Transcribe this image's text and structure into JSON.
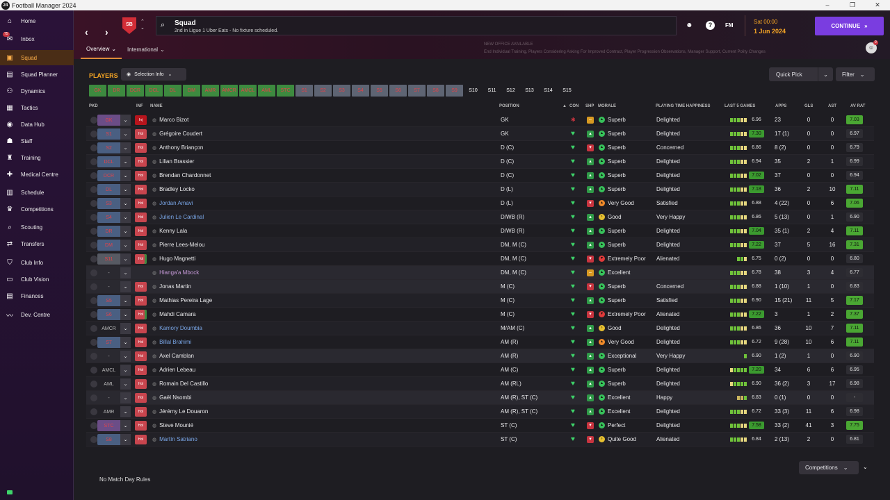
{
  "window": {
    "title": "Football Manager 2024",
    "app_icon": "24",
    "buttons": [
      "–",
      "❐",
      "✕"
    ]
  },
  "sidebar": {
    "items": [
      {
        "label": "Home",
        "icon": "home-icon",
        "glyph": "⌂"
      },
      {
        "label": "Inbox",
        "icon": "inbox-icon",
        "glyph": "✉",
        "badge": "75"
      },
      {
        "label": "Squad",
        "icon": "shirt-icon",
        "glyph": "▣",
        "active": true
      },
      {
        "label": "Squad Planner",
        "icon": "planner-icon",
        "glyph": "▤"
      },
      {
        "label": "Dynamics",
        "icon": "dynamics-icon",
        "glyph": "⚇"
      },
      {
        "label": "Tactics",
        "icon": "tactics-icon",
        "glyph": "▦"
      },
      {
        "label": "Data Hub",
        "icon": "data-hub-icon",
        "glyph": "◉"
      },
      {
        "label": "Staff",
        "icon": "staff-icon",
        "glyph": "☗"
      },
      {
        "label": "Training",
        "icon": "training-icon",
        "glyph": "♜"
      },
      {
        "label": "Medical Centre",
        "icon": "medical-icon",
        "glyph": "✚"
      },
      {
        "label": "Schedule",
        "icon": "schedule-icon",
        "glyph": "▥"
      },
      {
        "label": "Competitions",
        "icon": "trophy-icon",
        "glyph": "♛"
      },
      {
        "label": "Scouting",
        "icon": "scouting-icon",
        "glyph": "⌕"
      },
      {
        "label": "Transfers",
        "icon": "transfers-icon",
        "glyph": "⇄"
      },
      {
        "label": "Club Info",
        "icon": "club-info-icon",
        "glyph": "⛉"
      },
      {
        "label": "Club Vision",
        "icon": "club-vision-icon",
        "glyph": "▭"
      },
      {
        "label": "Finances",
        "icon": "finances-icon",
        "glyph": "▤"
      },
      {
        "label": "Dev. Centre",
        "icon": "dev-centre-icon",
        "glyph": "〰"
      }
    ]
  },
  "header": {
    "club_crest": "SB",
    "title": "Squad",
    "subtitle": "2nd in Ligue 1 Uber Eats - No fixture scheduled.",
    "fm_label": "FM",
    "date_line1": "Sat 00:00",
    "date_line2": "1 Jun 2024",
    "continue_label": "CONTINUE",
    "tabs": [
      "Overview",
      "International"
    ],
    "news_title": "NEW OFFICE AVAILABLE",
    "news_text": "End Individual Training, Players Considering Asking For Improved Contract, Player Progression Observations, Manager Support, Current Polity Changes",
    "avatar_badge": "9"
  },
  "toolbar": {
    "players_label": "PLAYERS",
    "selection_info_label": "Selection Info",
    "quick_pick_label": "Quick Pick",
    "filter_label": "Filter"
  },
  "positions": [
    {
      "label": "GK",
      "style": "green"
    },
    {
      "label": "DR",
      "style": "green"
    },
    {
      "label": "DCR",
      "style": "green"
    },
    {
      "label": "DCL",
      "style": "green"
    },
    {
      "label": "DL",
      "style": "green"
    },
    {
      "label": "DM",
      "style": "green"
    },
    {
      "label": "AMR",
      "style": "green"
    },
    {
      "label": "AMCR",
      "style": "green"
    },
    {
      "label": "AMCL",
      "style": "green"
    },
    {
      "label": "AML",
      "style": "green"
    },
    {
      "label": "STC",
      "style": "green"
    },
    {
      "label": "S1",
      "style": "gray"
    },
    {
      "label": "S2",
      "style": "gray"
    },
    {
      "label": "S3",
      "style": "gray"
    },
    {
      "label": "S4",
      "style": "gray"
    },
    {
      "label": "S5",
      "style": "gray"
    },
    {
      "label": "S6",
      "style": "gray"
    },
    {
      "label": "S7",
      "style": "gray"
    },
    {
      "label": "S8",
      "style": "gray"
    },
    {
      "label": "S9",
      "style": "gray"
    },
    {
      "label": "S10",
      "style": "plain"
    },
    {
      "label": "S11",
      "style": "plain"
    },
    {
      "label": "S12",
      "style": "plain"
    },
    {
      "label": "S13",
      "style": "plain"
    },
    {
      "label": "S14",
      "style": "plain"
    },
    {
      "label": "S15",
      "style": "plain"
    }
  ],
  "columns": {
    "pkd": "PKD",
    "inf": "INF",
    "name": "NAME",
    "position": "POSITION",
    "con": "CON",
    "shp": "SHP",
    "morale": "MORALE",
    "pth": "PLAYING TIME HAPPINESS",
    "last5": "LAST 5 GAMES",
    "apps": "APPS",
    "gls": "GLS",
    "ast": "AST",
    "avrat": "AV RAT",
    "sort_indicator": "▲"
  },
  "players": [
    {
      "pkd": "GK",
      "pkd_style": "purple",
      "inf": "Inj",
      "inf_style": "inj",
      "name": "Marco Bizot",
      "name_style": "",
      "position": "GK",
      "con": "cross",
      "shp": "y",
      "morale": "Superb",
      "morale_style": "g",
      "pth": "Delighted",
      "bars": "gggww",
      "last5": "6.96",
      "last5_hi": false,
      "apps": "23",
      "gls": "0",
      "ast": "0",
      "avrat": "7.03",
      "avrat_hi": true
    },
    {
      "pkd": "S1",
      "pkd_style": "blue",
      "inf": "Hol",
      "inf_style": "hol",
      "name": "Grégoire Coudert",
      "name_style": "",
      "position": "GK",
      "con": "heart",
      "shp": "g",
      "morale": "Superb",
      "morale_style": "g",
      "pth": "Delighted",
      "bars": "gggww",
      "last5": "7.30",
      "last5_hi": true,
      "apps": "17 (1)",
      "gls": "0",
      "ast": "0",
      "avrat": "6.97",
      "avrat_hi": false
    },
    {
      "pkd": "S2",
      "pkd_style": "blue",
      "inf": "Hol",
      "inf_style": "hol",
      "name": "Anthony Briançon",
      "name_style": "",
      "position": "D (C)",
      "con": "heart",
      "shp": "r",
      "morale": "Superb",
      "morale_style": "g",
      "pth": "Concerned",
      "bars": "gggww",
      "last5": "6.86",
      "last5_hi": false,
      "apps": "8 (2)",
      "gls": "0",
      "ast": "0",
      "avrat": "6.79",
      "avrat_hi": false
    },
    {
      "pkd": "DCL",
      "pkd_style": "blue",
      "inf": "Hol",
      "inf_style": "hol",
      "name": "Lilian Brassier",
      "name_style": "",
      "position": "D (C)",
      "con": "heart",
      "shp": "g",
      "morale": "Superb",
      "morale_style": "g",
      "pth": "Delighted",
      "bars": "gggww",
      "last5": "6.94",
      "last5_hi": false,
      "apps": "35",
      "gls": "2",
      "ast": "1",
      "avrat": "6.99",
      "avrat_hi": false
    },
    {
      "pkd": "DCR",
      "pkd_style": "blue",
      "inf": "Hol",
      "inf_style": "hol",
      "name": "Brendan Chardonnet",
      "name_style": "",
      "position": "D (C)",
      "con": "heart",
      "shp": "g",
      "morale": "Superb",
      "morale_style": "g",
      "pth": "Delighted",
      "bars": "gggww",
      "last5": "7.02",
      "last5_hi": true,
      "apps": "37",
      "gls": "0",
      "ast": "0",
      "avrat": "6.94",
      "avrat_hi": false
    },
    {
      "pkd": "DL",
      "pkd_style": "blue",
      "inf": "Hol",
      "inf_style": "hol",
      "name": "Bradley Locko",
      "name_style": "",
      "position": "D (L)",
      "con": "heart",
      "shp": "g",
      "morale": "Superb",
      "morale_style": "g",
      "pth": "Delighted",
      "bars": "gggww",
      "last5": "7.18",
      "last5_hi": true,
      "apps": "36",
      "gls": "2",
      "ast": "10",
      "avrat": "7.11",
      "avrat_hi": true
    },
    {
      "pkd": "S3",
      "pkd_style": "blue",
      "inf": "Hol",
      "inf_style": "hol",
      "name": "Jordan Amavi",
      "name_style": "link",
      "position": "D (L)",
      "con": "heart",
      "shp": "r",
      "morale": "Very Good",
      "morale_style": "o",
      "pth": "Satisfied",
      "bars": "gggww",
      "last5": "6.88",
      "last5_hi": false,
      "apps": "4 (22)",
      "gls": "0",
      "ast": "6",
      "avrat": "7.06",
      "avrat_hi": true
    },
    {
      "pkd": "S4",
      "pkd_style": "blue",
      "inf": "Hol",
      "inf_style": "hol",
      "name": "Julien Le Cardinal",
      "name_style": "link",
      "position": "D/WB (R)",
      "con": "heart",
      "shp": "g",
      "morale": "Good",
      "morale_style": "y",
      "pth": "Very Happy",
      "bars": "gggww",
      "last5": "6.86",
      "last5_hi": false,
      "apps": "5 (13)",
      "gls": "0",
      "ast": "1",
      "avrat": "6.90",
      "avrat_hi": false
    },
    {
      "pkd": "DR",
      "pkd_style": "blue",
      "inf": "Hol",
      "inf_style": "hol",
      "name": "Kenny Lala",
      "name_style": "",
      "position": "D/WB (R)",
      "con": "heart",
      "shp": "g",
      "morale": "Superb",
      "morale_style": "g",
      "pth": "Delighted",
      "bars": "gggww",
      "last5": "7.04",
      "last5_hi": true,
      "apps": "35 (1)",
      "gls": "2",
      "ast": "4",
      "avrat": "7.11",
      "avrat_hi": true
    },
    {
      "pkd": "DM",
      "pkd_style": "blue",
      "inf": "Hol",
      "inf_style": "hol",
      "name": "Pierre Lees-Melou",
      "name_style": "",
      "position": "DM, M (C)",
      "con": "heart",
      "shp": "g",
      "morale": "Superb",
      "morale_style": "g",
      "pth": "Delighted",
      "bars": "gggww",
      "last5": "7.22",
      "last5_hi": true,
      "apps": "37",
      "gls": "5",
      "ast": "16",
      "avrat": "7.31",
      "avrat_hi": true
    },
    {
      "pkd": "S11",
      "pkd_style": "gray",
      "inf": "Hol",
      "inf_style": "holg",
      "name": "Hugo Magnetti",
      "name_style": "",
      "position": "DM, M (C)",
      "con": "heart",
      "shp": "r",
      "morale": "Extremely Poor",
      "morale_style": "r",
      "pth": "Alienated",
      "bars": "ggw",
      "last5": "6.75",
      "last5_hi": false,
      "apps": "0 (2)",
      "gls": "0",
      "ast": "0",
      "avrat": "6.80",
      "avrat_hi": false
    },
    {
      "pkd": "-",
      "pkd_style": "none",
      "inf": "",
      "inf_style": "",
      "name": "Hianga'a Mbock",
      "name_style": "purp",
      "position": "DM, M (C)",
      "con": "heart",
      "shp": "y",
      "morale": "Excellent",
      "morale_style": "g",
      "pth": "",
      "bars": "gggww",
      "last5": "6.78",
      "last5_hi": false,
      "apps": "38",
      "gls": "3",
      "ast": "4",
      "avrat": "6.77",
      "avrat_hi": false
    },
    {
      "pkd": "-",
      "pkd_style": "none",
      "inf": "Hol",
      "inf_style": "hol",
      "name": "Jonas Martin",
      "name_style": "",
      "position": "M (C)",
      "con": "heart",
      "shp": "r",
      "morale": "Superb",
      "morale_style": "g",
      "pth": "Concerned",
      "bars": "gggww",
      "last5": "6.88",
      "last5_hi": false,
      "apps": "1 (10)",
      "gls": "1",
      "ast": "0",
      "avrat": "6.83",
      "avrat_hi": false
    },
    {
      "pkd": "S5",
      "pkd_style": "blue",
      "inf": "Hol",
      "inf_style": "hol",
      "name": "Mathias Pereira Lage",
      "name_style": "",
      "position": "M (C)",
      "con": "heart",
      "shp": "g",
      "morale": "Superb",
      "morale_style": "g",
      "pth": "Satisfied",
      "bars": "gggww",
      "last5": "6.90",
      "last5_hi": false,
      "apps": "15 (21)",
      "gls": "11",
      "ast": "5",
      "avrat": "7.17",
      "avrat_hi": true
    },
    {
      "pkd": "S6",
      "pkd_style": "blue",
      "inf": "Hol",
      "inf_style": "holg",
      "name": "Mahdi Camara",
      "name_style": "",
      "position": "M (C)",
      "con": "heart",
      "shp": "r",
      "morale": "Extremely Poor",
      "morale_style": "r",
      "pth": "Alienated",
      "bars": "gggww",
      "last5": "7.22",
      "last5_hi": true,
      "apps": "3",
      "gls": "1",
      "ast": "2",
      "avrat": "7.37",
      "avrat_hi": true
    },
    {
      "pkd": "AMCR",
      "pkd_style": "none",
      "inf": "Hol",
      "inf_style": "hol",
      "name": "Kamory Doumbia",
      "name_style": "link",
      "position": "M/AM (C)",
      "con": "heart",
      "shp": "g",
      "morale": "Good",
      "morale_style": "y",
      "pth": "Delighted",
      "bars": "gggww",
      "last5": "6.86",
      "last5_hi": false,
      "apps": "36",
      "gls": "10",
      "ast": "7",
      "avrat": "7.11",
      "avrat_hi": true
    },
    {
      "pkd": "S7",
      "pkd_style": "blue",
      "inf": "Hol",
      "inf_style": "hol",
      "name": "Billal Brahimi",
      "name_style": "link",
      "position": "AM (R)",
      "con": "heart",
      "shp": "g",
      "morale": "Very Good",
      "morale_style": "o",
      "pth": "Delighted",
      "bars": "gggww",
      "last5": "6.72",
      "last5_hi": false,
      "apps": "9 (28)",
      "gls": "10",
      "ast": "6",
      "avrat": "7.11",
      "avrat_hi": true
    },
    {
      "pkd": "-",
      "pkd_style": "none",
      "inf": "Hol",
      "inf_style": "hol",
      "name": "Axel Camblan",
      "name_style": "",
      "position": "AM (R)",
      "con": "heart",
      "shp": "g",
      "morale": "Exceptional",
      "morale_style": "g",
      "pth": "Very Happy",
      "bars": "g",
      "last5": "6.90",
      "last5_hi": false,
      "apps": "1 (2)",
      "gls": "1",
      "ast": "0",
      "avrat": "6.90",
      "avrat_hi": false
    },
    {
      "pkd": "AMCL",
      "pkd_style": "none",
      "inf": "Hol",
      "inf_style": "hol",
      "name": "Adrien Lebeau",
      "name_style": "",
      "position": "AM (C)",
      "con": "heart",
      "shp": "g",
      "morale": "Superb",
      "morale_style": "g",
      "pth": "Delighted",
      "bars": "wgggg",
      "last5": "7.20",
      "last5_hi": true,
      "apps": "34",
      "gls": "6",
      "ast": "6",
      "avrat": "6.95",
      "avrat_hi": false
    },
    {
      "pkd": "AML",
      "pkd_style": "none",
      "inf": "Hol",
      "inf_style": "hol",
      "name": "Romain Del Castillo",
      "name_style": "",
      "position": "AM (RL)",
      "con": "heart",
      "shp": "g",
      "morale": "Superb",
      "morale_style": "g",
      "pth": "Delighted",
      "bars": "wgggg",
      "last5": "6.90",
      "last5_hi": false,
      "apps": "36 (2)",
      "gls": "3",
      "ast": "17",
      "avrat": "6.98",
      "avrat_hi": false
    },
    {
      "pkd": "-",
      "pkd_style": "none",
      "inf": "Hol",
      "inf_style": "hol",
      "name": "Gaël Nsombi",
      "name_style": "",
      "position": "AM (R), ST (C)",
      "con": "heart",
      "shp": "g",
      "morale": "Excellent",
      "morale_style": "g",
      "pth": "Happy",
      "bars": "oog",
      "last5": "6.83",
      "last5_hi": false,
      "apps": "0 (1)",
      "gls": "0",
      "ast": "0",
      "avrat": "-",
      "avrat_hi": false
    },
    {
      "pkd": "AMR",
      "pkd_style": "none",
      "inf": "Hol",
      "inf_style": "hol",
      "name": "Jérémy Le Douaron",
      "name_style": "",
      "position": "AM (R), ST (C)",
      "con": "heart",
      "shp": "g",
      "morale": "Excellent",
      "morale_style": "g",
      "pth": "Delighted",
      "bars": "gggww",
      "last5": "6.72",
      "last5_hi": false,
      "apps": "33 (3)",
      "gls": "11",
      "ast": "6",
      "avrat": "6.98",
      "avrat_hi": false
    },
    {
      "pkd": "STC",
      "pkd_style": "purple",
      "inf": "Hol",
      "inf_style": "hol",
      "name": "Steve Mounié",
      "name_style": "",
      "position": "ST (C)",
      "con": "heart",
      "shp": "r",
      "morale": "Perfect",
      "morale_style": "g",
      "pth": "Delighted",
      "bars": "gggww",
      "last5": "7.58",
      "last5_hi": true,
      "apps": "33 (2)",
      "gls": "41",
      "ast": "3",
      "avrat": "7.75",
      "avrat_hi": true
    },
    {
      "pkd": "S8",
      "pkd_style": "blue",
      "inf": "Hol",
      "inf_style": "hol",
      "name": "Martín Satriano",
      "name_style": "link",
      "position": "ST (C)",
      "con": "heart",
      "shp": "r",
      "morale": "Quite Good",
      "morale_style": "y",
      "pth": "Alienated",
      "bars": "gggww",
      "last5": "6.84",
      "last5_hi": false,
      "apps": "2 (13)",
      "gls": "2",
      "ast": "0",
      "avrat": "6.81",
      "avrat_hi": false
    }
  ],
  "footer": {
    "no_match_day_rules": "No Match Day Rules",
    "competitions_label": "Competitions"
  }
}
